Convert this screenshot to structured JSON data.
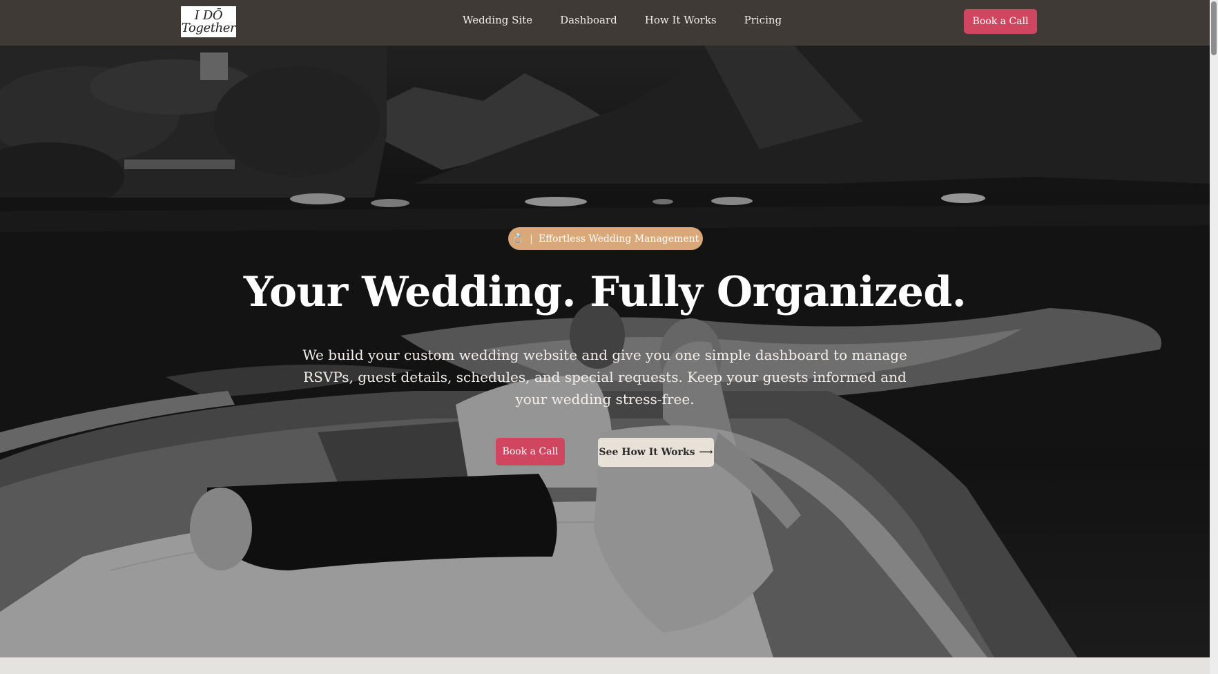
{
  "brand": {
    "logo_line1": "I DŌ",
    "logo_line2": "Together"
  },
  "nav": {
    "links": [
      "Wedding Site",
      "Dashboard",
      "How It Works",
      "Pricing"
    ],
    "cta_label": "Book a Call"
  },
  "hero": {
    "badge_icon": "ring-icon",
    "badge_separator": "|",
    "badge_text": "Effortless Wedding Management",
    "headline": "Your Wedding. Fully Organized.",
    "subtext": "We build your custom wedding website and give you one simple dashboard to manage RSVPs, guest details, schedules, and special requests. Keep your guests informed and your wedding stress-free.",
    "primary_cta": "Book a Call",
    "secondary_cta": "See How It Works",
    "secondary_cta_arrow": "⟶"
  },
  "colors": {
    "nav_bg": "#403a36",
    "accent": "#d0455f",
    "badge": "#d9a878",
    "secondary_button": "#e8e1d8"
  }
}
